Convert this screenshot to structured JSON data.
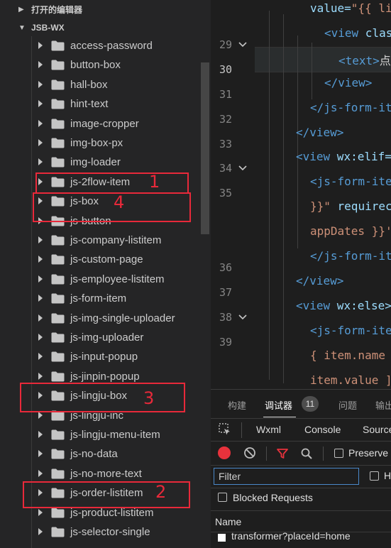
{
  "sidebar": {
    "open_editors_label": "打开的编辑器",
    "project_label": "JSB-WX",
    "folders": [
      "access-password",
      "button-box",
      "hall-box",
      "hint-text",
      "image-cropper",
      "img-box-px",
      "img-loader",
      "js-2flow-item",
      "js-box",
      "js-button",
      "js-company-listitem",
      "js-custom-page",
      "js-employee-listitem",
      "js-form-item",
      "js-img-single-uploader",
      "js-img-uploader",
      "js-input-popup",
      "js-jinpin-popup",
      "js-lingju-box",
      "js-lingju-inc",
      "js-lingju-menu-item",
      "js-no-data",
      "js-no-more-text",
      "js-order-listitem",
      "js-product-listitem",
      "js-selector-single"
    ],
    "annotations": [
      {
        "number": "1",
        "color": "#e8293a"
      },
      {
        "number": "4",
        "color": "#e8293a"
      },
      {
        "number": "3",
        "color": "#e8293a"
      },
      {
        "number": "2",
        "color": "#e8293a"
      }
    ]
  },
  "editor": {
    "line_numbers": [
      "29",
      "30",
      "31",
      "32",
      "33",
      "34",
      "35",
      "36",
      "37",
      "38",
      "39"
    ],
    "active_line": "30",
    "code_lines": [
      {
        "parts": [
          {
            "t": "value=",
            "c": "attr"
          },
          {
            "t": "\"{{ li",
            "c": "str"
          }
        ]
      },
      {
        "parts": [
          {
            "t": "<view",
            "c": "tag"
          },
          {
            "t": " clas",
            "c": "attr"
          }
        ]
      },
      {
        "parts": [
          {
            "t": "<text>",
            "c": "tag"
          },
          {
            "t": "点",
            "c": "txt"
          }
        ]
      },
      {
        "parts": [
          {
            "t": "</view>",
            "c": "tag"
          }
        ]
      },
      {
        "parts": [
          {
            "t": "</js-form-it",
            "c": "tag"
          }
        ]
      },
      {
        "parts": [
          {
            "t": "</view>",
            "c": "tag"
          }
        ]
      },
      {
        "parts": [
          {
            "t": "<view",
            "c": "tag"
          },
          {
            "t": " wx:elif=",
            "c": "attr"
          }
        ]
      },
      {
        "parts": [
          {
            "t": "<js-form-ite",
            "c": "tag"
          }
        ]
      },
      {
        "parts": [
          {
            "t": "}}\"",
            "c": "str"
          },
          {
            "t": " requirec",
            "c": "attr"
          }
        ]
      },
      {
        "parts": [
          {
            "t": "appDates }}'",
            "c": "str"
          }
        ]
      },
      {
        "parts": [
          {
            "t": "</js-form-it",
            "c": "tag"
          }
        ]
      },
      {
        "parts": [
          {
            "t": "</view>",
            "c": "tag"
          }
        ]
      },
      {
        "parts": [
          {
            "t": "<view",
            "c": "tag"
          },
          {
            "t": " wx:else>",
            "c": "attr"
          }
        ]
      },
      {
        "parts": [
          {
            "t": "<js-form-ite",
            "c": "tag"
          }
        ]
      },
      {
        "parts": [
          {
            "t": "{ item.name",
            "c": "str"
          }
        ]
      },
      {
        "parts": [
          {
            "t": "item.value ]",
            "c": "str"
          }
        ]
      }
    ]
  },
  "panel": {
    "tabs": [
      "构建",
      "调试器",
      "问题",
      "输出"
    ],
    "active_tab": "调试器",
    "badge": "11",
    "devtools_tabs": [
      "Wxml",
      "Console",
      "Source"
    ],
    "preserve_label": "Preserve",
    "filter_placeholder": "Filter",
    "blocked_requests_label": "Blocked Requests",
    "name_header": "Name",
    "request_row": "transformer?placeId=home",
    "colors": {
      "record": "#e8323c",
      "filter_icon": "#e8323c",
      "accent": "#4a88c9"
    }
  }
}
